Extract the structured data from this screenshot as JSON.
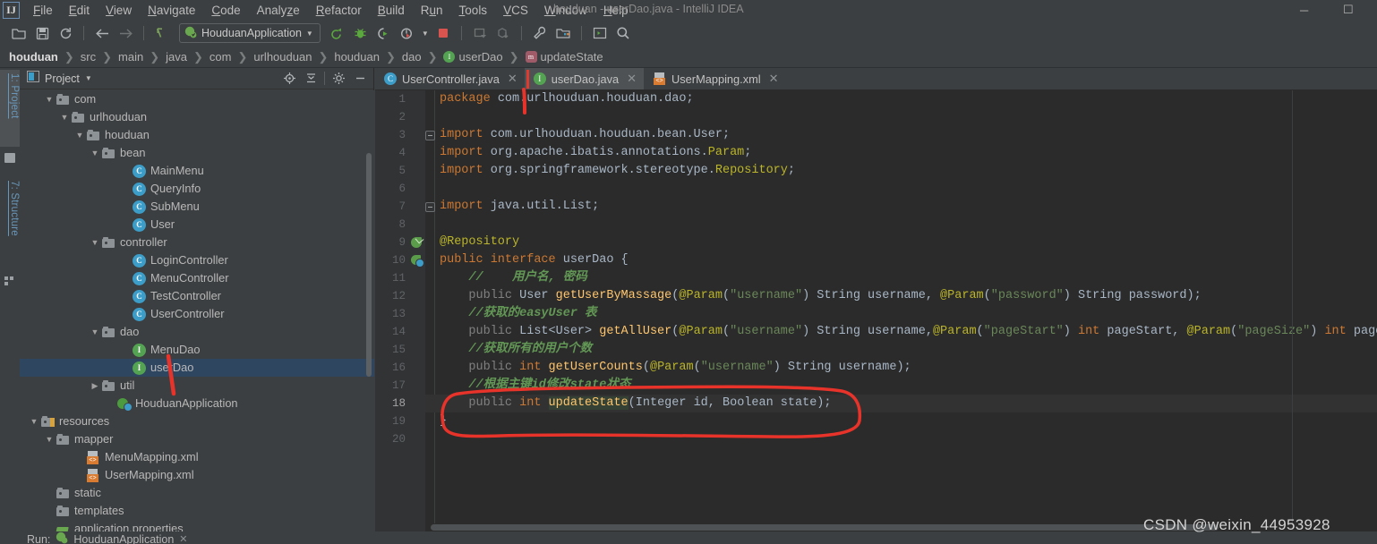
{
  "window": {
    "title": "houduan - userDao.java - IntelliJ IDEA",
    "logo": "IJ",
    "minimize": "─",
    "maximize": "☐"
  },
  "menubar": [
    {
      "label": "File",
      "mnemonic": "F"
    },
    {
      "label": "Edit",
      "mnemonic": "E"
    },
    {
      "label": "View",
      "mnemonic": "V"
    },
    {
      "label": "Navigate",
      "mnemonic": "N"
    },
    {
      "label": "Code",
      "mnemonic": "C"
    },
    {
      "label": "Analyze",
      "mnemonic": "z"
    },
    {
      "label": "Refactor",
      "mnemonic": "R"
    },
    {
      "label": "Build",
      "mnemonic": "B"
    },
    {
      "label": "Run",
      "mnemonic": "u"
    },
    {
      "label": "Tools",
      "mnemonic": "T"
    },
    {
      "label": "VCS",
      "mnemonic": "V"
    },
    {
      "label": "Window",
      "mnemonic": "W"
    },
    {
      "label": "Help",
      "mnemonic": "H"
    }
  ],
  "toolbar": {
    "run_config": "HouduanApplication",
    "icons": [
      "open-project-icon",
      "save-all-icon",
      "sync-icon",
      "back-icon",
      "forward-icon",
      "pointer-icon"
    ],
    "run_icons": [
      "run-icon",
      "debug-icon",
      "run-coverage-icon",
      "profiler-icon",
      "stop-icon",
      "update-app-icon",
      "pull-icon",
      "settings-wrench-icon",
      "project-structure-icon",
      "terminal-icon",
      "search-everywhere-icon"
    ]
  },
  "breadcrumb": [
    {
      "label": "houduan",
      "icon": null
    },
    {
      "label": "src",
      "icon": null
    },
    {
      "label": "main",
      "icon": null
    },
    {
      "label": "java",
      "icon": null
    },
    {
      "label": "com",
      "icon": null
    },
    {
      "label": "urlhouduan",
      "icon": null
    },
    {
      "label": "houduan",
      "icon": null
    },
    {
      "label": "dao",
      "icon": null
    },
    {
      "label": "userDao",
      "icon": "interface-icon"
    },
    {
      "label": "updateState",
      "icon": "method-icon"
    }
  ],
  "toolwindow_bar": [
    {
      "label": "1: Project",
      "num": "1",
      "active": true
    },
    {
      "label": "7: Structure",
      "num": "7",
      "active": false
    }
  ],
  "project_panel": {
    "title": "Project",
    "header_icons": [
      "locate-icon",
      "collapse-all-icon",
      "gear-icon",
      "hide-icon"
    ],
    "tree": [
      {
        "label": "com",
        "indent": 5,
        "arrow": "▼",
        "icon": "folder",
        "sel": false
      },
      {
        "label": "urlhouduan",
        "indent": 6,
        "arrow": "▼",
        "icon": "folder",
        "sel": false
      },
      {
        "label": "houduan",
        "indent": 7,
        "arrow": "▼",
        "icon": "folder",
        "sel": false
      },
      {
        "label": "bean",
        "indent": 8,
        "arrow": "▼",
        "icon": "folder",
        "sel": false
      },
      {
        "label": "MainMenu",
        "indent": 10,
        "arrow": "",
        "icon": "class",
        "sel": false
      },
      {
        "label": "QueryInfo",
        "indent": 10,
        "arrow": "",
        "icon": "class",
        "sel": false
      },
      {
        "label": "SubMenu",
        "indent": 10,
        "arrow": "",
        "icon": "class",
        "sel": false
      },
      {
        "label": "User",
        "indent": 10,
        "arrow": "",
        "icon": "class",
        "sel": false
      },
      {
        "label": "controller",
        "indent": 8,
        "arrow": "▼",
        "icon": "folder",
        "sel": false
      },
      {
        "label": "LoginController",
        "indent": 10,
        "arrow": "",
        "icon": "class",
        "sel": false
      },
      {
        "label": "MenuController",
        "indent": 10,
        "arrow": "",
        "icon": "class",
        "sel": false
      },
      {
        "label": "TestController",
        "indent": 10,
        "arrow": "",
        "icon": "class",
        "sel": false
      },
      {
        "label": "UserController",
        "indent": 10,
        "arrow": "",
        "icon": "class",
        "sel": false
      },
      {
        "label": "dao",
        "indent": 8,
        "arrow": "▼",
        "icon": "folder",
        "sel": false
      },
      {
        "label": "MenuDao",
        "indent": 10,
        "arrow": "",
        "icon": "iface",
        "sel": false
      },
      {
        "label": "userDao",
        "indent": 10,
        "arrow": "",
        "icon": "iface",
        "sel": true
      },
      {
        "label": "util",
        "indent": 8,
        "arrow": "▶",
        "icon": "folder",
        "sel": false
      },
      {
        "label": "HouduanApplication",
        "indent": 9,
        "arrow": "",
        "icon": "spring",
        "sel": false
      },
      {
        "label": "resources",
        "indent": 4,
        "arrow": "▼",
        "icon": "res",
        "sel": false
      },
      {
        "label": "mapper",
        "indent": 5,
        "arrow": "▼",
        "icon": "folder",
        "sel": false
      },
      {
        "label": "MenuMapping.xml",
        "indent": 7,
        "arrow": "",
        "icon": "xml",
        "sel": false
      },
      {
        "label": "UserMapping.xml",
        "indent": 7,
        "arrow": "",
        "icon": "xml",
        "sel": false
      },
      {
        "label": "static",
        "indent": 5,
        "arrow": "",
        "icon": "folder",
        "sel": false
      },
      {
        "label": "templates",
        "indent": 5,
        "arrow": "",
        "icon": "folder",
        "sel": false
      },
      {
        "label": "application.properties",
        "indent": 5,
        "arrow": "",
        "icon": "props",
        "sel": false
      }
    ]
  },
  "editor_tabs": [
    {
      "label": "UserController.java",
      "icon": "class-icon",
      "active": false,
      "close": "✕"
    },
    {
      "label": "userDao.java",
      "icon": "interface-icon",
      "active": true,
      "close": "✕"
    },
    {
      "label": "UserMapping.xml",
      "icon": "xml-icon",
      "active": false,
      "close": "✕"
    }
  ],
  "editor": {
    "filename": "userDao.java",
    "current_line": 18,
    "lines": [
      {
        "n": 1,
        "gutter": null,
        "fold": false
      },
      {
        "n": 2,
        "gutter": null,
        "fold": false
      },
      {
        "n": 3,
        "gutter": null,
        "fold": true
      },
      {
        "n": 4,
        "gutter": null,
        "fold": false
      },
      {
        "n": 5,
        "gutter": null,
        "fold": false
      },
      {
        "n": 6,
        "gutter": null,
        "fold": false
      },
      {
        "n": 7,
        "gutter": null,
        "fold": true
      },
      {
        "n": 8,
        "gutter": null,
        "fold": false
      },
      {
        "n": 9,
        "gutter": "bean-marker-icon",
        "fold": false
      },
      {
        "n": 10,
        "gutter": "implemented-marker-icon",
        "fold": false
      },
      {
        "n": 11,
        "gutter": null,
        "fold": false
      },
      {
        "n": 12,
        "gutter": null,
        "fold": false
      },
      {
        "n": 13,
        "gutter": null,
        "fold": false
      },
      {
        "n": 14,
        "gutter": null,
        "fold": false
      },
      {
        "n": 15,
        "gutter": null,
        "fold": false
      },
      {
        "n": 16,
        "gutter": null,
        "fold": false
      },
      {
        "n": 17,
        "gutter": null,
        "fold": false
      },
      {
        "n": 18,
        "gutter": null,
        "fold": false
      },
      {
        "n": 19,
        "gutter": null,
        "fold": false
      },
      {
        "n": 20,
        "gutter": null,
        "fold": false
      }
    ],
    "source_text": [
      "package com.urlhouduan.houduan.dao;",
      "",
      "import com.urlhouduan.houduan.bean.User;",
      "import org.apache.ibatis.annotations.Param;",
      "import org.springframework.stereotype.Repository;",
      "",
      "import java.util.List;",
      "",
      "@Repository",
      "public interface userDao {",
      "    //    用户名, 密码",
      "    public User getUserByMassage(@Param(\"username\") String username, @Param(\"password\") String password);",
      "    //获取的easyUser 表",
      "    public List<User> getAllUser(@Param(\"username\") String username,@Param(\"pageStart\") int pageStart, @Param(\"pageSize\") int pageSi",
      "    //获取所有的用户个数",
      "    public int getUserCounts(@Param(\"username\") String username);",
      "    //根据主键id修改state状态",
      "    public int updateState(Integer id, Boolean state);",
      "}",
      ""
    ]
  },
  "annotations": {
    "circle_target_lines": [
      17,
      18
    ],
    "tree_mark_target": "userDao",
    "tab_mark_target": "userDao.java",
    "color": "#e8332a"
  },
  "bottom": {
    "run_label": "Run:",
    "run_config": "HouduanApplication",
    "close": "✕"
  },
  "watermark": "CSDN @weixin_44953928",
  "colors": {
    "chrome_bg": "#3c3f41",
    "editor_bg": "#2b2b2b",
    "gutter_bg": "#313335",
    "selection_bg": "#2f4661",
    "tab_active_bg": "#4e5254",
    "keyword": "#cc7832",
    "string": "#6a8759",
    "comment": "#629755",
    "annotation": "#bbb529",
    "method": "#ffc66d",
    "identifier": "#a9b7c6",
    "dimmed": "#808080",
    "annotation_red": "#e8332a"
  }
}
